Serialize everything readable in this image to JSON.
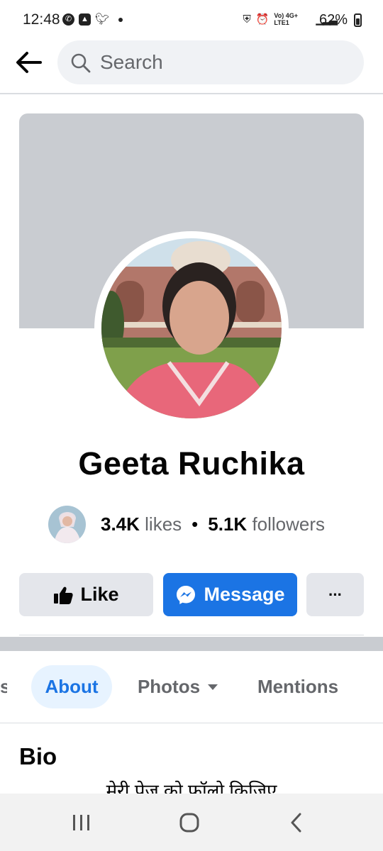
{
  "status_bar": {
    "time": "12:48",
    "battery": "62%",
    "network": "Vo) 4G+ LTE1",
    "left_icons": [
      "whatsapp-icon",
      "gallery-icon",
      "twitter-icon"
    ],
    "right_icons": [
      "vpn-icon",
      "alarm-icon",
      "signal-icon",
      "battery-icon"
    ]
  },
  "header": {
    "search_placeholder": "Search"
  },
  "profile": {
    "name": "Geeta Ruchika",
    "likes_count": "3.4K",
    "likes_label": "likes",
    "separator": "•",
    "followers_count": "5.1K",
    "followers_label": "followers"
  },
  "actions": {
    "like": "Like",
    "message": "Message",
    "more": "···"
  },
  "tabs": {
    "partial": "s",
    "about": "About",
    "photos": "Photos",
    "mentions": "Mentions",
    "active": "About"
  },
  "bio": {
    "heading": "Bio",
    "text": "मेरी पेज को फॉलो किजिए"
  },
  "colors": {
    "accent": "#1b74e4",
    "cover": "#c9ccd1",
    "button_grey": "#e4e6eb",
    "secondary_text": "#65676b"
  }
}
